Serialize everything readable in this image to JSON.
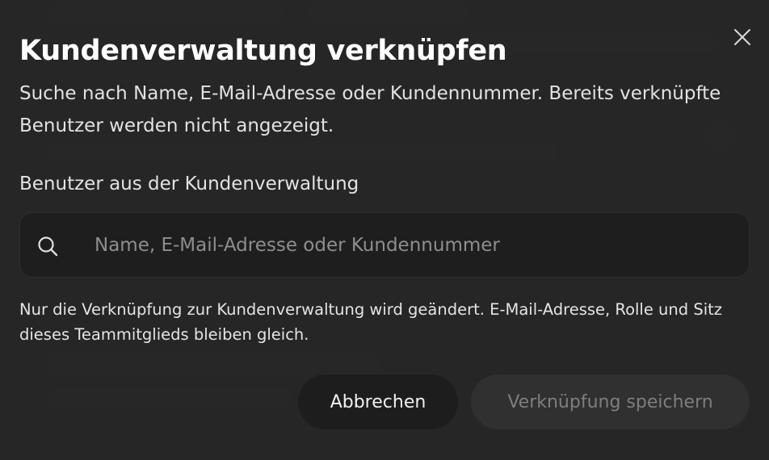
{
  "dialog": {
    "title": "Kundenverwaltung verknüpfen",
    "description": "Suche nach Name, E-Mail-Adresse oder Kundennummer. Bereits verknüpfte Benutzer werden nicht angezeigt.",
    "field_label": "Benutzer aus der Kundenverwaltung",
    "search": {
      "value": "",
      "placeholder": "Name, E-Mail-Adresse oder Kundennummer",
      "icon": "search-icon"
    },
    "hint": "Nur die Verknüpfung zur Kundenverwaltung wird geändert. E-Mail-Adresse, Rolle und Sitz dieses Teammitglieds bleiben gleich.",
    "buttons": {
      "cancel_label": "Abbrechen",
      "save_label": "Verknüpfung speichern",
      "save_enabled": false
    },
    "close_icon": "close-icon"
  },
  "colors": {
    "overlay": "#262626",
    "input_bg": "#1e1e1e",
    "text_primary": "#ffffff",
    "text_secondary": "#e2e2e2",
    "placeholder": "#8e8e8e",
    "disabled_text": "#7e7e7e"
  }
}
